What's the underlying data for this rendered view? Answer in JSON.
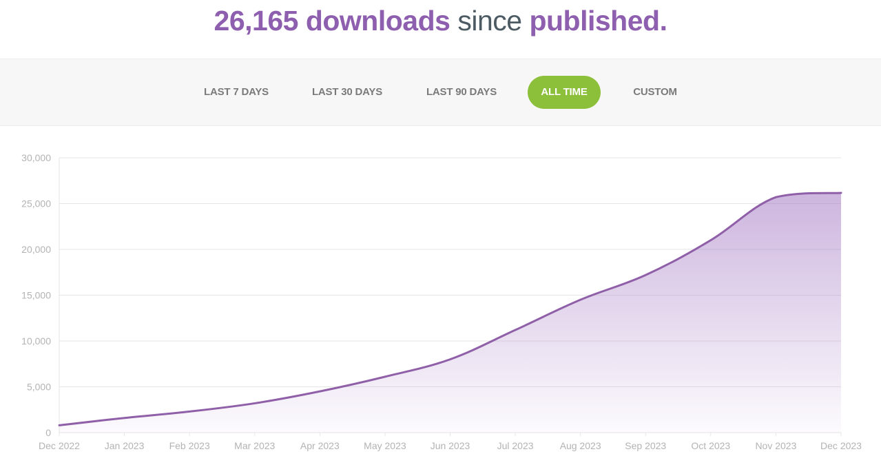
{
  "header": {
    "count": "26,165",
    "downloads_word": "downloads",
    "since_word": "since",
    "published_word": "published."
  },
  "tabs": [
    {
      "label": "LAST 7 DAYS",
      "active": false
    },
    {
      "label": "LAST 30 DAYS",
      "active": false
    },
    {
      "label": "LAST 90 DAYS",
      "active": false
    },
    {
      "label": "ALL TIME",
      "active": true
    },
    {
      "label": "CUSTOM",
      "active": false
    }
  ],
  "colors": {
    "accent_purple": "#8d5fae",
    "text_dark": "#4c5a63",
    "active_green": "#8cbf3a",
    "line": "#8f5fa8",
    "fill": "#9b6cbd",
    "grid": "#e6e6e6",
    "axis_text": "#b3b3b3"
  },
  "chart_data": {
    "type": "area",
    "xlabel": "",
    "ylabel": "",
    "grid": true,
    "ylim": [
      0,
      30000
    ],
    "yticks": [
      0,
      5000,
      10000,
      15000,
      20000,
      25000,
      30000
    ],
    "ytick_labels": [
      "0",
      "5,000",
      "10,000",
      "15,000",
      "20,000",
      "25,000",
      "30,000"
    ],
    "categories": [
      "Dec 2022",
      "Jan 2023",
      "Feb 2023",
      "Mar 2023",
      "Apr 2023",
      "May 2023",
      "Jun 2023",
      "Jul 2023",
      "Aug 2023",
      "Sep 2023",
      "Oct 2023",
      "Nov 2023",
      "Dec 2023"
    ],
    "series": [
      {
        "values": [
          800,
          1600,
          2300,
          3200,
          4500,
          6100,
          8000,
          11200,
          14500,
          17200,
          21000,
          25700,
          26165
        ]
      }
    ]
  }
}
